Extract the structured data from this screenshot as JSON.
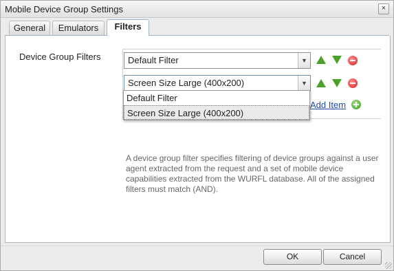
{
  "dialog": {
    "title": "Mobile Device Group Settings",
    "close_glyph": "×"
  },
  "tabs": [
    {
      "label": "General",
      "active": false
    },
    {
      "label": "Emulators",
      "active": false
    },
    {
      "label": "Filters",
      "active": true
    }
  ],
  "filters": {
    "label": "Device Group Filters",
    "rows": [
      {
        "value": "Default Filter"
      },
      {
        "value": "Screen Size Large (400x200)"
      }
    ],
    "add_item_label": "Add Item",
    "help_text": "A device group filter specifies filtering of device groups against a user agent extracted from the request and a set of mobile device capabilities extracted from the WURFL database. All of the assigned filters must match (AND).",
    "dropdown_options": [
      "Default Filter",
      "Screen Size Large (400x200)"
    ],
    "dropdown_selected": "Screen Size Large (400x200)"
  },
  "footer": {
    "ok_label": "OK",
    "cancel_label": "Cancel"
  },
  "icons": [
    "close-icon",
    "dropdown-arrow-icon",
    "move-up-icon",
    "move-down-icon",
    "remove-icon",
    "add-icon",
    "resize-grip-icon"
  ],
  "colors": {
    "accent_green": "#4aa229",
    "remove_red": "#d91f1f",
    "link_blue": "#1a4aa8"
  }
}
